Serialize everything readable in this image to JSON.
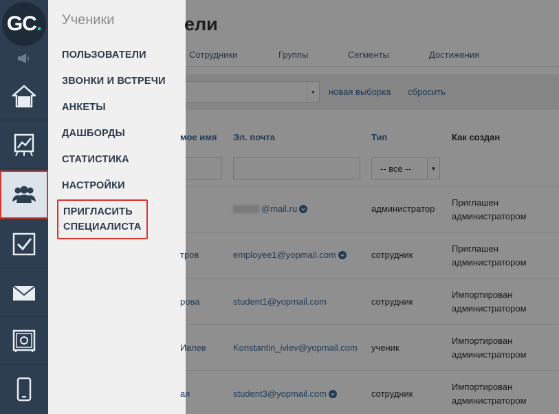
{
  "logo": {
    "g": "G",
    "c": "C",
    "dot": "."
  },
  "submenu": {
    "title": "Ученики",
    "items": [
      {
        "label": "ПОЛЬЗОВАТЕЛИ"
      },
      {
        "label": "ЗВОНКИ И ВСТРЕЧИ"
      },
      {
        "label": "АНКЕТЫ"
      },
      {
        "label": "ДАШБОРДЫ"
      },
      {
        "label": "СТАТИСТИКА"
      },
      {
        "label": "НАСТРОЙКИ"
      }
    ],
    "invite": {
      "line1": "ПРИГЛАСИТЬ",
      "line2": "СПЕЦИАЛИСТА"
    }
  },
  "main": {
    "title_partial": "ели",
    "tabs": [
      {
        "label": "Сотрудники"
      },
      {
        "label": "Группы"
      },
      {
        "label": "Сегменты"
      },
      {
        "label": "Достижения"
      }
    ],
    "links": {
      "new_selection": "новая выборка",
      "reset": "сбросить"
    },
    "columns": {
      "name": "мое имя",
      "email": "Эл. почта",
      "type": "Тип",
      "created": "Как создан"
    },
    "type_filter": "-- все --",
    "rows": [
      {
        "name": "",
        "email": "@mail.ru",
        "type": "администратор",
        "created1": "Приглашен",
        "created2": "администратором"
      },
      {
        "name": "тров",
        "email": "employee1@yopmail.com",
        "type": "сотрудник",
        "created1": "Приглашен",
        "created2": "администратором"
      },
      {
        "name": "рова",
        "email": "student1@yopmail.com",
        "type": "сотрудник",
        "created1": "Импортирован",
        "created2": "администратором"
      },
      {
        "name": "Ивлев",
        "email": "Konstantin_ivlev@yopmail.com",
        "type": "ученик",
        "created1": "Импортирован",
        "created2": "администратором"
      },
      {
        "name": "ая",
        "email": "student3@yopmail.com",
        "type": "сотрудник",
        "created1": "Импортирован",
        "created2": "администратором"
      }
    ]
  },
  "colors": {
    "rail": "#2c3e50",
    "accent_teal": "#1ec8b4",
    "highlight_red": "#d9342b",
    "link": "#1f3b56"
  }
}
